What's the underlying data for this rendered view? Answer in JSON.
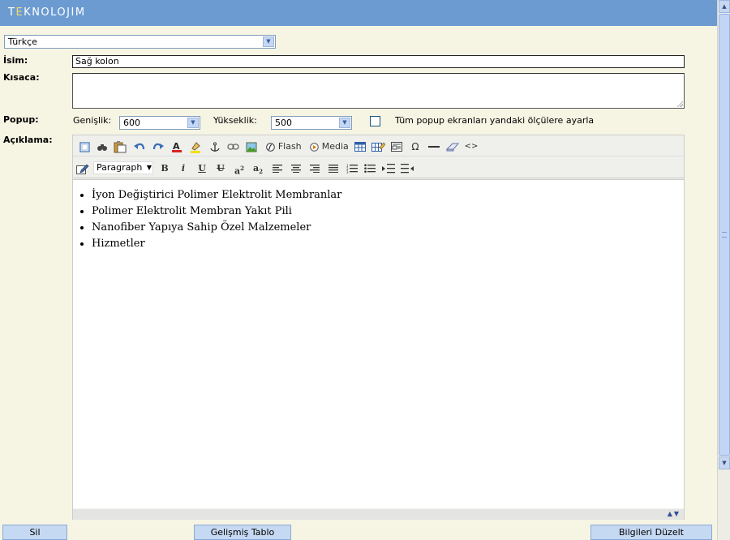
{
  "header": {
    "brand_prefix": "T",
    "brand_e": "E",
    "brand_rest": "KNOLOJIM"
  },
  "language": {
    "selected": "Türkçe"
  },
  "fields": {
    "name_label": "İsim:",
    "name_value": "Sağ kolon",
    "summary_label": "Kısaca:",
    "summary_value": "",
    "popup_label": "Popup:",
    "width_label": "Genişlik:",
    "width_value": "600",
    "height_label": "Yükseklik:",
    "height_value": "500",
    "apply_all_label": "Tüm popup ekranları yandaki ölçülere ayarla",
    "apply_all_checked": false,
    "description_label": "Açıklama:"
  },
  "editor": {
    "toolbar1": {
      "flash_label": "Flash",
      "media_label": "Media",
      "omega": "Ω"
    },
    "toolbar2": {
      "format_selected": "Paragraph",
      "bold": "B",
      "italic": "i",
      "underline": "U",
      "strike": "U",
      "sup_base": "a",
      "sup_exp": "2",
      "sub_base": "a",
      "sub_exp": "2"
    },
    "content_items": [
      "İyon Değiştirici Polimer Elektrolit Membranlar",
      "Polimer Elektrolit Membran Yakıt Pili",
      "Nanofiber Yapıya Sahip Özel Malzemeler",
      "Hizmetler"
    ]
  },
  "buttons": {
    "delete": "Sil",
    "advanced_table": "Gelişmiş Tablo",
    "update_info": "Bilgileri Düzelt"
  },
  "colors": {
    "header_bg": "#6b9bd1",
    "page_bg": "#f6f5e4",
    "button_bg": "#c6d9f2"
  }
}
